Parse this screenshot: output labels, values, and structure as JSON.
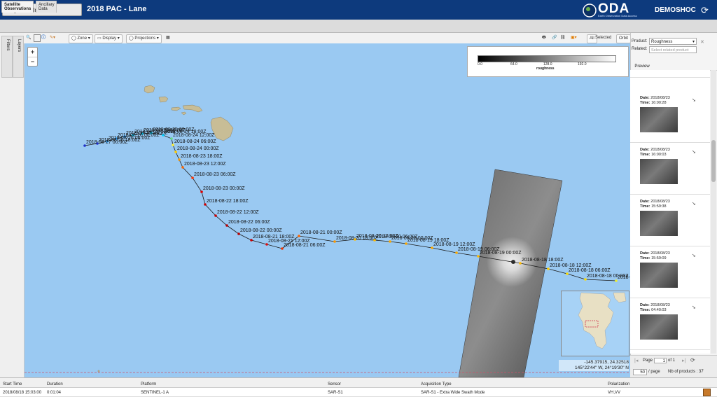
{
  "header": {
    "region_button": "Region Of Interest",
    "title": "2018 PAC - Lane",
    "logo_text": "ODA",
    "logo_subtitle": "Earth Observation Data Access",
    "user": "DEMOSHOC"
  },
  "tabs": [
    {
      "line1": "Satellite",
      "line2": "Observations"
    },
    {
      "line1": "Ancillary",
      "line2": "Data"
    }
  ],
  "rail": {
    "filters": "Filters",
    "layers": "Layers"
  },
  "toolbar": {
    "zone": "Zone",
    "display": "Display",
    "projections": "Projections",
    "all": "All",
    "selected": "Selected",
    "orbit": "Orbit"
  },
  "map": {
    "zoom_in": "+",
    "zoom_out": "−",
    "colorbar": {
      "ticks": [
        "0.0",
        "64.0",
        "128.0",
        "192.0"
      ],
      "label": "roughness"
    },
    "track_labels": [
      "2018-08-27 00:00Z",
      "2018-08-26 18:00Z",
      "2018-08-26 06:00Z",
      "2018-08-26 00:00Z",
      "2018-08-25 18:00Z",
      "2018-08-25 12:00Z",
      "2018-08-25 06:00Z",
      "2018-08-25 00:00Z",
      "2018-08-24 18:00Z",
      "2018-08-24 12:00Z",
      "2018-08-24 06:00Z",
      "2018-08-24 00:00Z",
      "2018-08-23 18:00Z",
      "2018-08-23 12:00Z",
      "2018-08-23 06:00Z",
      "2018-08-23 00:00Z",
      "2018-08-22 18:00Z",
      "2018-08-22 12:00Z",
      "2018-08-22 06:00Z",
      "2018-08-22 00:00Z",
      "2018-08-21 18:00Z",
      "2018-08-21 12:00Z",
      "2018-08-21 06:00Z",
      "2018-08-21 00:00Z",
      "2018-08-20 18:00Z",
      "2018-08-20 12:00Z",
      "2018-08-20 06:00Z",
      "2018-08-20 00:00Z",
      "2018-08-19 18:00Z",
      "2018-08-19 12:00Z",
      "2018-08-19 06:00Z",
      "2018-08-19 00:00Z",
      "2018-08-18 18:00Z",
      "2018-08-18 12:00Z",
      "2018-08-18 06:00Z",
      "2018-08-18 00:00Z",
      "2018-08-17 18:00Z"
    ],
    "coords_line1": "-145.37915, 24.32518",
    "coords_line2": "145°22'44\" W, 24°19'30\" N"
  },
  "right_panel": {
    "product_label": "Product:",
    "product_value": "Roughness",
    "related_label": "Related:",
    "related_placeholder": "Select related product",
    "preview_tab": "Preview",
    "items": [
      {
        "date": "2018/08/23",
        "time": "16:00:28"
      },
      {
        "date": "2018/08/23",
        "time": "16:00:03"
      },
      {
        "date": "2018/08/23",
        "time": "15:59:38"
      },
      {
        "date": "2018/08/23",
        "time": "15:59:09"
      },
      {
        "date": "2018/08/23",
        "time": "04:40:03"
      }
    ],
    "date_label": "Date:",
    "time_label": "Time:",
    "pager": {
      "page_label": "Page",
      "page_value": "1",
      "of_label": "of 1",
      "per_page": "50",
      "per_page_label": "/ page",
      "count_label": "Nb of products : 37"
    }
  },
  "table": {
    "headers": [
      "Start Time",
      "Duration",
      "Platform",
      "Sensor",
      "Acquisition Type",
      "Polarization"
    ],
    "row": [
      "2018/08/18 15:03:00",
      "0:01:04",
      "SENTINEL-1 A",
      "SAR-S1",
      "SAR-S1 - Extra Wide Swath Mode",
      "VH,VV"
    ]
  },
  "colors": {
    "header": "#0d3a7d",
    "ocean": "#9ac9f2",
    "land": "#c8bd96",
    "track": "#1a1a1a"
  }
}
